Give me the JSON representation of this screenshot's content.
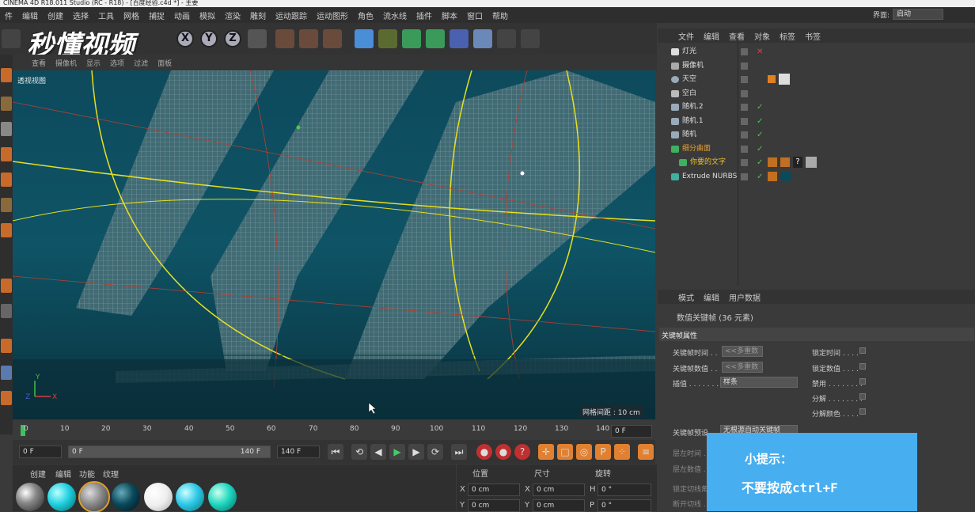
{
  "window_title": "CINEMA 4D R18.011 Studio (RC - R18) - [百度经验.c4d *] - 主要",
  "menu": [
    "件",
    "编辑",
    "创建",
    "选择",
    "工具",
    "网格",
    "捕捉",
    "动画",
    "模拟",
    "渲染",
    "雕刻",
    "运动跟踪",
    "运动图形",
    "角色",
    "流水线",
    "插件",
    "脚本",
    "窗口",
    "帮助"
  ],
  "layout_label": "界面:",
  "layout_value": "启动",
  "watermark": "秒懂视频",
  "axis_buttons": [
    "X",
    "Y",
    "Z"
  ],
  "viewport_menu": [
    "查看",
    "摄像机",
    "显示",
    "选项",
    "过滤",
    "面板"
  ],
  "viewport_label": "透视视图",
  "grid_spacing": "网格间距 : 10 cm",
  "timeline_ticks": [
    "0",
    "10",
    "20",
    "30",
    "40",
    "50",
    "60",
    "70",
    "80",
    "90",
    "100",
    "110",
    "120",
    "130",
    "140"
  ],
  "frame_current": "0 F",
  "frame_start": "0 F",
  "frame_slider_start": "0 F",
  "frame_slider_end": "140 F",
  "frame_end": "140 F",
  "mat_menu": [
    "创建",
    "编辑",
    "功能",
    "纹理"
  ],
  "coord_headers": [
    "位置",
    "尺寸",
    "旋转"
  ],
  "coord_rows": [
    {
      "a": "X",
      "v1": "0 cm",
      "b": "X",
      "v2": "0 cm",
      "c": "H",
      "v3": "0 °"
    },
    {
      "a": "Y",
      "v1": "0 cm",
      "b": "Y",
      "v2": "0 cm",
      "c": "P",
      "v3": "0 °"
    }
  ],
  "object_menu": [
    "文件",
    "编辑",
    "查看",
    "对象",
    "标签",
    "书签"
  ],
  "objects": [
    {
      "name": "灯光",
      "color": "#ddd"
    },
    {
      "name": "摄像机",
      "color": "#ddd"
    },
    {
      "name": "天空",
      "color": "#ddd"
    },
    {
      "name": "空白",
      "color": "#ddd"
    },
    {
      "name": "随机.2",
      "color": "#ddd"
    },
    {
      "name": "随机.1",
      "color": "#ddd"
    },
    {
      "name": "随机",
      "color": "#ddd"
    },
    {
      "name": "细分曲面",
      "color": "#e8a030"
    },
    {
      "name": "你要的文字",
      "color": "#e8c030"
    },
    {
      "name": "Extrude NURBS",
      "color": "#ddd"
    }
  ],
  "attr_menu": [
    "模式",
    "编辑",
    "用户数据"
  ],
  "attr_title": "数值关键帧 (36 元素)",
  "attr_section": "关键帧属性",
  "attr_fields": {
    "key_time": "关键帧时间 . .",
    "key_value": "关键帧数值 . .",
    "interp": "插值 . . . . . . . .",
    "multi": "<<多重数",
    "interp_val": "样条",
    "lock_time": "锁定时间 . . . .",
    "lock_value": "锁定数值 . . . .",
    "disable": "禁用 . . . . . . . .",
    "break": "分解 . . . . . . . .",
    "break_color": "分解颜色 . . . .",
    "preset": "关键帧预设",
    "preset_val": "无根源自动关键帧",
    "left_time": "层左时间 . .",
    "left_value": "层左数值 . .",
    "lock_tangent": "锁定切线角",
    "break_tangent": "断开切线 . ."
  },
  "tip_title": "小提示：",
  "tip_body": "不要按成ctrl+F"
}
